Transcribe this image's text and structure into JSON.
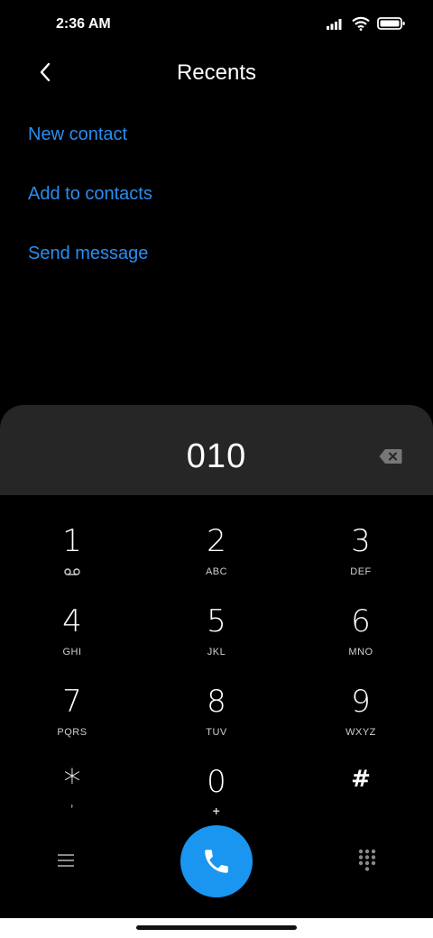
{
  "status_bar": {
    "time": "2:36 AM",
    "icons": [
      "signal-icon",
      "wifi-icon",
      "battery-icon"
    ]
  },
  "header": {
    "back_icon": "chevron-left-icon",
    "title": "Recents"
  },
  "actions": [
    {
      "label": "New contact"
    },
    {
      "label": "Add to contacts"
    },
    {
      "label": "Send message"
    }
  ],
  "dialpad": {
    "number": "010",
    "backspace_icon": "backspace-icon",
    "keys": [
      {
        "digit": "1",
        "letters": "",
        "icon": "voicemail-icon"
      },
      {
        "digit": "2",
        "letters": "ABC"
      },
      {
        "digit": "3",
        "letters": "DEF"
      },
      {
        "digit": "4",
        "letters": "GHI"
      },
      {
        "digit": "5",
        "letters": "JKL"
      },
      {
        "digit": "6",
        "letters": "MNO"
      },
      {
        "digit": "7",
        "letters": "PQRS"
      },
      {
        "digit": "8",
        "letters": "TUV"
      },
      {
        "digit": "9",
        "letters": "WXYZ"
      },
      {
        "digit": "*",
        "letters": ","
      },
      {
        "digit": "0",
        "letters": "+"
      },
      {
        "digit": "#",
        "letters": ""
      }
    ],
    "bottom": {
      "menu_icon": "menu-icon",
      "call_icon": "phone-icon",
      "keypad_icon": "dialpad-icon"
    }
  },
  "colors": {
    "accent": "#2a8df0",
    "call_button": "#1a96f0",
    "number_bar": "#262626",
    "background": "#000000"
  }
}
